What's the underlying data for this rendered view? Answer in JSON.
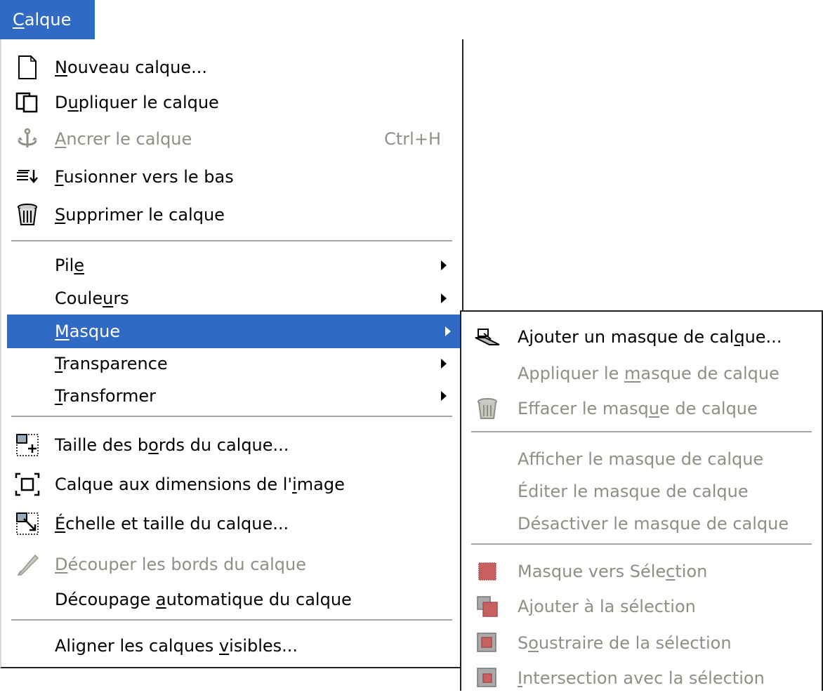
{
  "menubar": {
    "title_u": "C",
    "title_rest": "alque"
  },
  "menu": {
    "items": [
      {
        "pre": "",
        "acc": "N",
        "post": "ouveau calque...",
        "icon": "new-layer-icon",
        "disabled": false
      },
      {
        "pre": "D",
        "acc": "u",
        "post": "pliquer le calque",
        "icon": "duplicate-layer-icon",
        "disabled": false
      },
      {
        "pre": "",
        "acc": "A",
        "post": "ncrer le calque",
        "icon": "anchor-icon",
        "disabled": true,
        "shortcut": "Ctrl+H"
      },
      {
        "pre": "",
        "acc": "F",
        "post": "usionner vers le bas",
        "icon": "merge-down-icon",
        "disabled": false
      },
      {
        "pre": "",
        "acc": "S",
        "post": "upprimer le calque",
        "icon": "trash-icon",
        "disabled": false
      },
      {
        "pre": "Pil",
        "acc": "e",
        "post": "",
        "submenu": true
      },
      {
        "pre": "Coule",
        "acc": "u",
        "post": "rs",
        "submenu": true
      },
      {
        "pre": "",
        "acc": "M",
        "post": "asque",
        "submenu": true,
        "highlight": true
      },
      {
        "pre": "",
        "acc": "T",
        "post": "ransparence",
        "submenu": true
      },
      {
        "pre": "",
        "acc": "T",
        "post": "ransformer",
        "submenu": true
      },
      {
        "pre": "Taille des b",
        "acc": "o",
        "post": "rds du calque...",
        "icon": "layer-boundary-size-icon"
      },
      {
        "pre": "Calque aux dimensions de l'",
        "acc": "i",
        "post": "mage",
        "icon": "layer-to-image-size-icon"
      },
      {
        "pre": "",
        "acc": "É",
        "post": "chelle et taille du calque...",
        "icon": "scale-layer-icon"
      },
      {
        "pre": "",
        "acc": "D",
        "post": "écouper les bords du calque",
        "icon": "crop-icon",
        "disabled": true
      },
      {
        "pre": "Découpage ",
        "acc": "a",
        "post": "utomatique du calque"
      },
      {
        "pre": "Aligner les calques ",
        "acc": "v",
        "post": "isibles..."
      }
    ]
  },
  "submenu": {
    "items": [
      {
        "pre": "Ajouter un masque de cal",
        "acc": "q",
        "post": "ue...",
        "icon": "add-mask-icon",
        "disabled": false
      },
      {
        "pre": "Appliquer le ",
        "acc": "m",
        "post": "asque de calque",
        "disabled": true
      },
      {
        "pre": "Effacer le masq",
        "acc": "u",
        "post": "e de calque",
        "icon": "trash-icon",
        "disabled": true
      },
      {
        "pre": "Afficher le masque de calque",
        "acc": "",
        "post": "",
        "disabled": true
      },
      {
        "pre": "Éditer le masque de calque",
        "acc": "",
        "post": "",
        "disabled": true
      },
      {
        "pre": "Désactiver le masque de calque",
        "acc": "",
        "post": "",
        "disabled": true
      },
      {
        "pre": "Masque vers Séle",
        "acc": "c",
        "post": "tion",
        "icon": "mask-to-selection-icon",
        "disabled": true
      },
      {
        "pre": "A",
        "acc": "j",
        "post": "outer à la sélection",
        "icon": "add-to-selection-icon",
        "disabled": true
      },
      {
        "pre": "S",
        "acc": "o",
        "post": "ustraire de la sélection",
        "icon": "subtract-from-selection-icon",
        "disabled": true
      },
      {
        "pre": "",
        "acc": "I",
        "post": "ntersection avec la sélection",
        "icon": "intersect-selection-icon",
        "disabled": true
      }
    ]
  },
  "colors": {
    "highlight": "#316ac5",
    "disabled_text": "#8f8f86",
    "mask_red": "#c86060"
  }
}
